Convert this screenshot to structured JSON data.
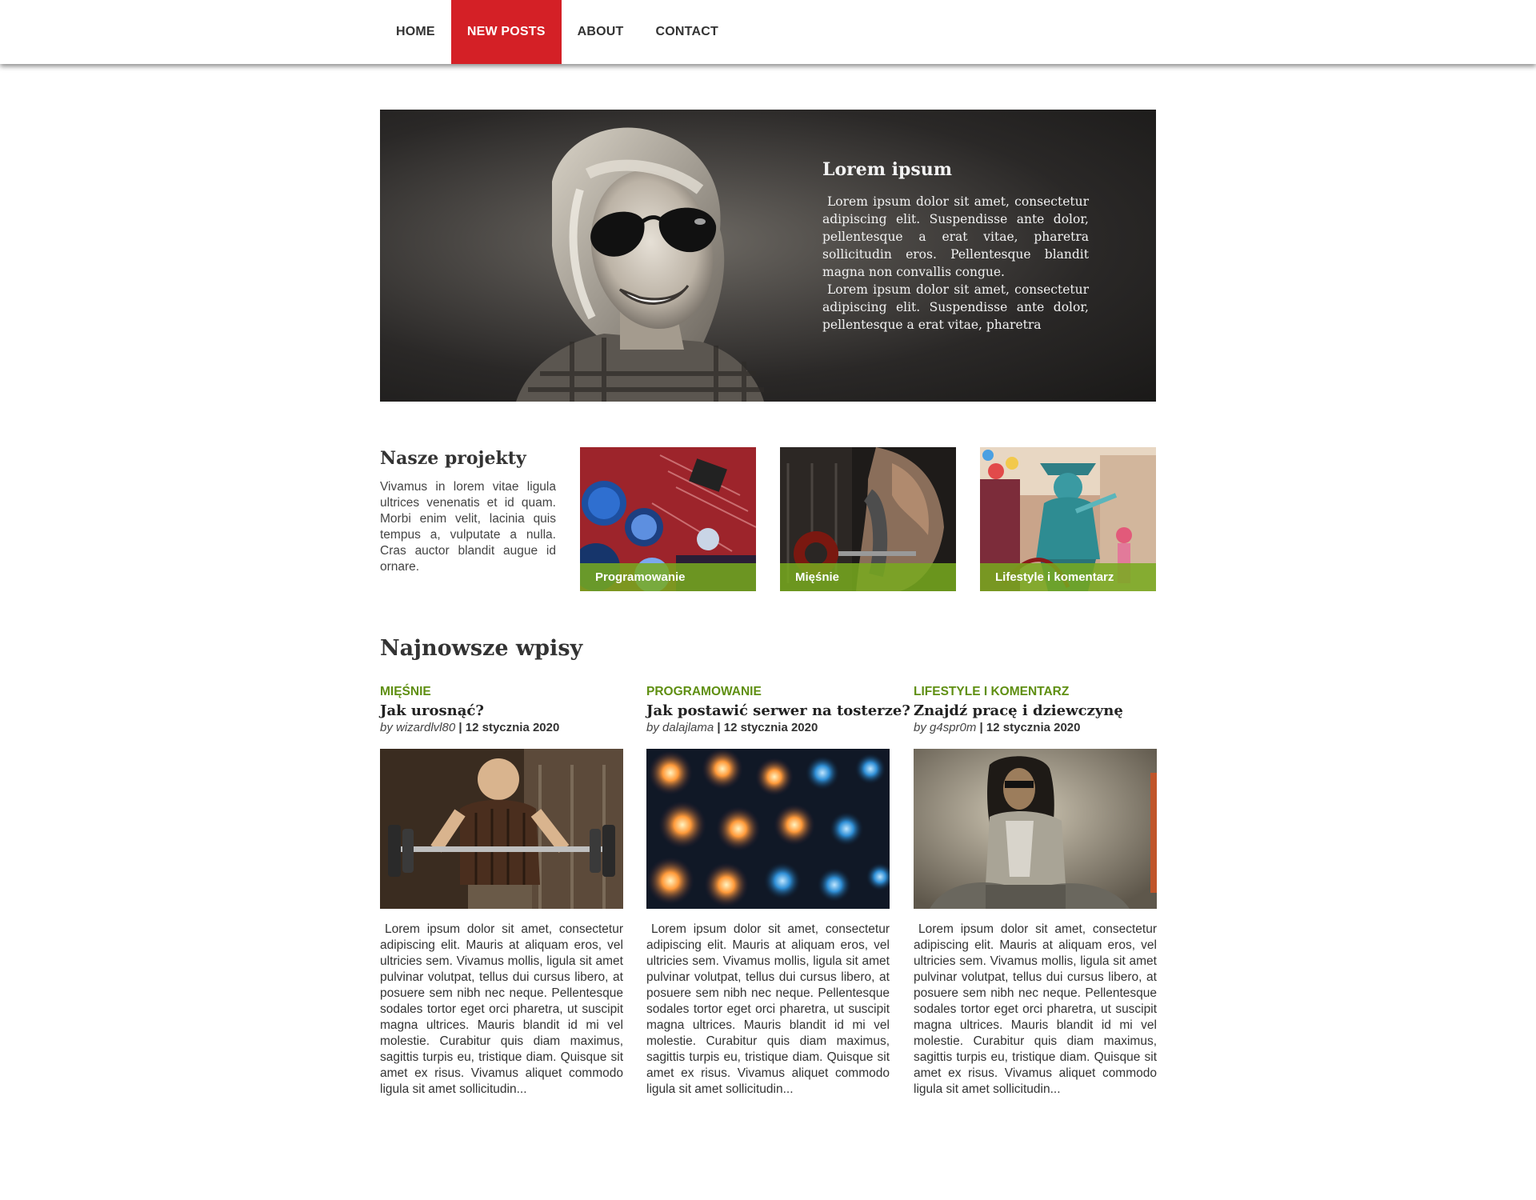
{
  "nav": {
    "items": [
      {
        "label": "HOME"
      },
      {
        "label": "NEW POSTS"
      },
      {
        "label": "ABOUT"
      },
      {
        "label": "CONTACT"
      }
    ],
    "active_color": "#d42026"
  },
  "hero": {
    "title": "Lorem ipsum",
    "paragraph_1": "Lorem ipsum dolor sit amet, consectetur adipiscing elit. Suspendisse ante dolor, pellentesque a erat vitae, pharetra sollicitudin eros. Pellentesque blandit magna non convallis congue.",
    "paragraph_2": "Lorem ipsum dolor sit amet, consectetur adipiscing elit. Suspendisse ante dolor, pellentesque a erat vitae, pharetra"
  },
  "projects": {
    "title": "Nasze projekty",
    "description": "Vivamus in lorem vitae ligula ultrices venenatis et id quam. Morbi enim velit, lacinia quis tempus a, vulputate a nulla. Cras auctor blandit augue id ornare.",
    "tiles": [
      {
        "label": "Programowanie"
      },
      {
        "label": "Mięśnie"
      },
      {
        "label": "Lifestyle i komentarz"
      }
    ],
    "label_color": "#78aa1e"
  },
  "posts": {
    "title": "Najnowsze wpisy",
    "items": [
      {
        "category": "MIĘŚNIE",
        "title": "Jak urosnąć?",
        "by": "by wizardlvl80",
        "date": "| 12 stycznia 2020",
        "body": "Lorem ipsum dolor sit amet, consectetur adipiscing elit. Mauris at aliquam eros, vel ultricies sem. Vivamus mollis, ligula sit amet pulvinar volutpat, tellus dui cursus libero, at posuere sem nibh nec neque. Pellentesque sodales tortor eget orci pharetra, ut suscipit magna ultrices. Mauris blandit id mi vel molestie. Curabitur quis diam maximus, sagittis turpis eu, tristique diam. Quisque sit amet ex risus. Vivamus aliquet commodo ligula sit amet sollicitudin..."
      },
      {
        "category": "PROGRAMOWANIE",
        "title": "Jak postawić serwer na tosterze?",
        "by": "by dalajlama",
        "date": "| 12 stycznia 2020",
        "body": "Lorem ipsum dolor sit amet, consectetur adipiscing elit. Mauris at aliquam eros, vel ultricies sem. Vivamus mollis, ligula sit amet pulvinar volutpat, tellus dui cursus libero, at posuere sem nibh nec neque. Pellentesque sodales tortor eget orci pharetra, ut suscipit magna ultrices. Mauris blandit id mi vel molestie. Curabitur quis diam maximus, sagittis turpis eu, tristique diam. Quisque sit amet ex risus. Vivamus aliquet commodo ligula sit amet sollicitudin..."
      },
      {
        "category": "LIFESTYLE I KOMENTARZ",
        "title": "Znajdź pracę i dziewczynę",
        "by": "by g4spr0m",
        "date": "| 12 stycznia 2020",
        "body": "Lorem ipsum dolor sit amet, consectetur adipiscing elit. Mauris at aliquam eros, vel ultricies sem. Vivamus mollis, ligula sit amet pulvinar volutpat, tellus dui cursus libero, at posuere sem nibh nec neque. Pellentesque sodales tortor eget orci pharetra, ut suscipit magna ultrices. Mauris blandit id mi vel molestie. Curabitur quis diam maximus, sagittis turpis eu, tristique diam. Quisque sit amet ex risus. Vivamus aliquet commodo ligula sit amet sollicitudin..."
      }
    ],
    "category_color": "#5f8f12"
  }
}
